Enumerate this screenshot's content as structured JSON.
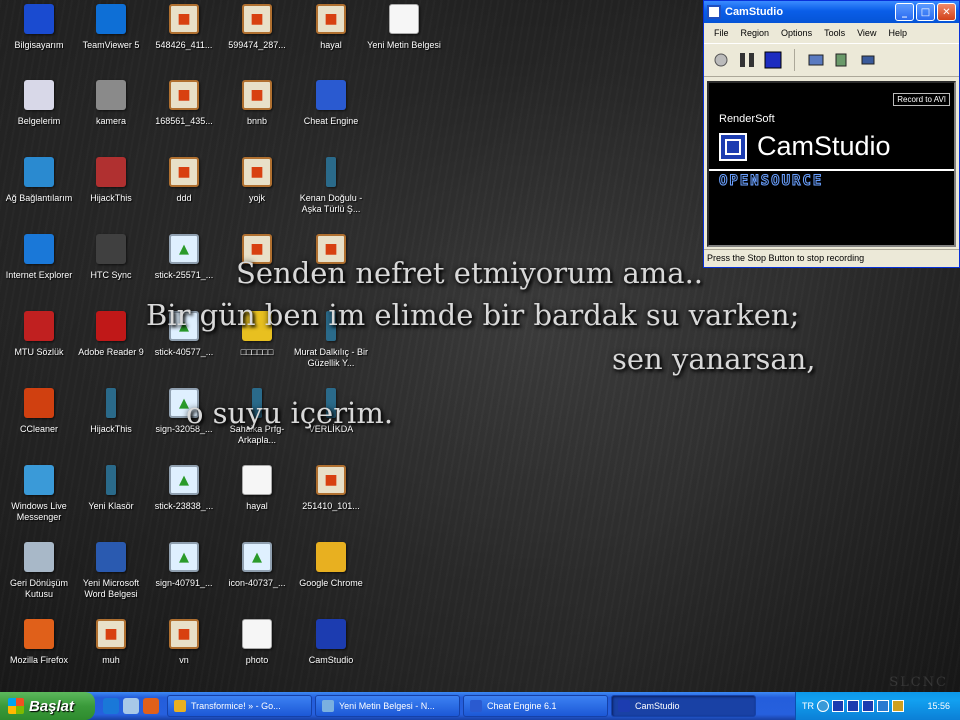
{
  "desktop": {
    "icons": [
      {
        "label": "Bilgisayarım",
        "icon": "computer-icon",
        "color": "#1a4bd0"
      },
      {
        "label": "TeamViewer 5",
        "icon": "teamviewer-icon",
        "color": "#0e6fd6"
      },
      {
        "label": "548426_411...",
        "icon": "image-icon"
      },
      {
        "label": "599474_287...",
        "icon": "image-icon"
      },
      {
        "label": "hayal",
        "icon": "image-icon"
      },
      {
        "label": "Yeni Metin Belgesi",
        "icon": "text-document-icon"
      },
      {
        "label": "Belgelerim",
        "icon": "documents-icon",
        "color": "#d8d8e8"
      },
      {
        "label": "kamera",
        "icon": "camera-icon",
        "color": "#8a8a8a"
      },
      {
        "label": "168561_435...",
        "icon": "image-icon"
      },
      {
        "label": "bnnb",
        "icon": "image-icon"
      },
      {
        "label": "Cheat Engine",
        "icon": "cheat-engine-icon",
        "color": "#2a5ad0"
      },
      {
        "label": "Ağ Bağlantılarım",
        "icon": "network-icon",
        "color": "#2a8ad0"
      },
      {
        "label": "HijackThis",
        "icon": "hijackthis-icon",
        "color": "#b03030"
      },
      {
        "label": "ddd",
        "icon": "image-icon"
      },
      {
        "label": "yojk",
        "icon": "image-icon"
      },
      {
        "label": "Kenan Doğulu - Aşka Türlü Ş...",
        "icon": "folder-icon"
      },
      {
        "label": "Internet Explorer",
        "icon": "internet-explorer-icon",
        "color": "#1a78d8"
      },
      {
        "label": "HTC Sync",
        "icon": "htc-sync-icon",
        "color": "#404040"
      },
      {
        "label": "stick-25571_...",
        "icon": "picture-icon"
      },
      {
        "label": "",
        "icon": "image-icon"
      },
      {
        "label": "",
        "icon": "image-icon"
      },
      {
        "label": "MTU Sözlük",
        "icon": "dictionary-icon",
        "color": "#c02020"
      },
      {
        "label": "Adobe Reader 9",
        "icon": "adobe-reader-icon",
        "color": "#c01818"
      },
      {
        "label": "stick-40577_...",
        "icon": "picture-icon"
      },
      {
        "label": "□□□□□□",
        "icon": "media-icon",
        "color": "#e8c020"
      },
      {
        "label": "Murat Dalkılıç - Bir Güzellik Y...",
        "icon": "folder-icon"
      },
      {
        "label": "CCleaner",
        "icon": "ccleaner-icon",
        "color": "#d04010"
      },
      {
        "label": "HijackThis",
        "icon": "folder-icon"
      },
      {
        "label": "sign-32058_...",
        "icon": "picture-icon"
      },
      {
        "label": "Sahaika Prfg-Arkapla...",
        "icon": "folder-icon"
      },
      {
        "label": "VERLİKDA",
        "icon": "folder-icon"
      },
      {
        "label": "Windows Live Messenger",
        "icon": "messenger-icon",
        "color": "#3a9ad8"
      },
      {
        "label": "Yeni Klasör",
        "icon": "folder-icon"
      },
      {
        "label": "stick-23838_...",
        "icon": "picture-icon"
      },
      {
        "label": "hayal",
        "icon": "text-document-icon"
      },
      {
        "label": "251410_101...",
        "icon": "image-icon"
      },
      {
        "label": "Geri Dönüşüm Kutusu",
        "icon": "recycle-bin-icon",
        "color": "#a8b8c8"
      },
      {
        "label": "Yeni Microsoft Word Belgesi",
        "icon": "word-document-icon",
        "color": "#2a5ab0"
      },
      {
        "label": "sign-40791_...",
        "icon": "picture-icon"
      },
      {
        "label": "icon-40737_...",
        "icon": "picture-icon"
      },
      {
        "label": "Google Chrome",
        "icon": "chrome-icon",
        "color": "#e8b020"
      },
      {
        "label": "Mozilla Firefox",
        "icon": "firefox-icon",
        "color": "#e0601a"
      },
      {
        "label": "muh",
        "icon": "image-icon"
      },
      {
        "label": "vn",
        "icon": "image-icon"
      },
      {
        "label": "photo",
        "icon": "text-document-icon"
      },
      {
        "label": "CamStudio",
        "icon": "camstudio-icon",
        "color": "#1c3cb0"
      }
    ]
  },
  "lyrics": {
    "line1": "Senden nefret etmiyorum ama..",
    "line2": "Bir gün ben im elimde bir bardak su varken;",
    "line3": "sen yanarsan,",
    "line4": "o suyu içerim."
  },
  "camstudio": {
    "title": "CamStudio",
    "menu": [
      "File",
      "Region",
      "Options",
      "Tools",
      "View",
      "Help"
    ],
    "record_avi": "Record to AVI",
    "render_soft": "RenderSoft",
    "product_name": "CamStudio",
    "open_source": "OPENSOURCE",
    "status": "Press the Stop Button to stop recording"
  },
  "taskbar": {
    "start_label": "Başlat",
    "tasks": [
      {
        "label": "Transformice! » - Go...",
        "color": "#e8b020"
      },
      {
        "label": "Yeni Metin Belgesi - N...",
        "color": "#7ab0e0"
      },
      {
        "label": "Cheat Engine 6.1",
        "color": "#2a5ad0"
      },
      {
        "label": "CamStudio",
        "color": "#1c3cb0",
        "active": true
      }
    ],
    "tray": {
      "language": "TR",
      "clock": "15:56"
    }
  },
  "watermark": "SLCNC"
}
